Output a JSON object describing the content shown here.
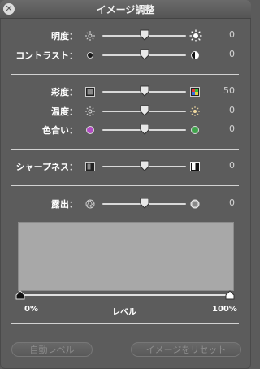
{
  "window": {
    "title": "イメージ調整",
    "close_symbol": "✕"
  },
  "sliders": [
    {
      "label": "明度：",
      "value": "0",
      "level": 0.5,
      "left_icon": "sun-dim-icon",
      "right_icon": "sun-bright-icon"
    },
    {
      "label": "コントラスト：",
      "value": "0",
      "level": 0.5,
      "left_icon": "contrast-low-icon",
      "right_icon": "contrast-high-icon"
    },
    {
      "label": "彩度：",
      "value": "50",
      "level": 0.5,
      "left_icon": "saturation-gray-icon",
      "right_icon": "saturation-color-icon"
    },
    {
      "label": "温度：",
      "value": "0",
      "level": 0.5,
      "left_icon": "temperature-cool-icon",
      "right_icon": "temperature-warm-icon"
    },
    {
      "label": "色合い：",
      "value": "0",
      "level": 0.5,
      "left_icon": "tint-magenta-icon",
      "right_icon": "tint-green-icon"
    },
    {
      "label": "シャープネス：",
      "value": "0",
      "level": 0.5,
      "left_icon": "sharpness-low-icon",
      "right_icon": "sharpness-high-icon"
    },
    {
      "label": "露出：",
      "value": "0",
      "level": 0.5,
      "left_icon": "exposure-low-icon",
      "right_icon": "exposure-high-icon"
    }
  ],
  "levels": {
    "min_label": "0%",
    "center_label": "レベル",
    "max_label": "100%",
    "black_point": 0.0,
    "white_point": 1.0
  },
  "buttons": {
    "auto_levels": "自動レベル",
    "reset": "イメージをリセット"
  },
  "colors": {
    "panel_background": "#5c5c5c",
    "histogram_background": "#a8a8a8",
    "disabled_text": "#8d8d8d"
  }
}
